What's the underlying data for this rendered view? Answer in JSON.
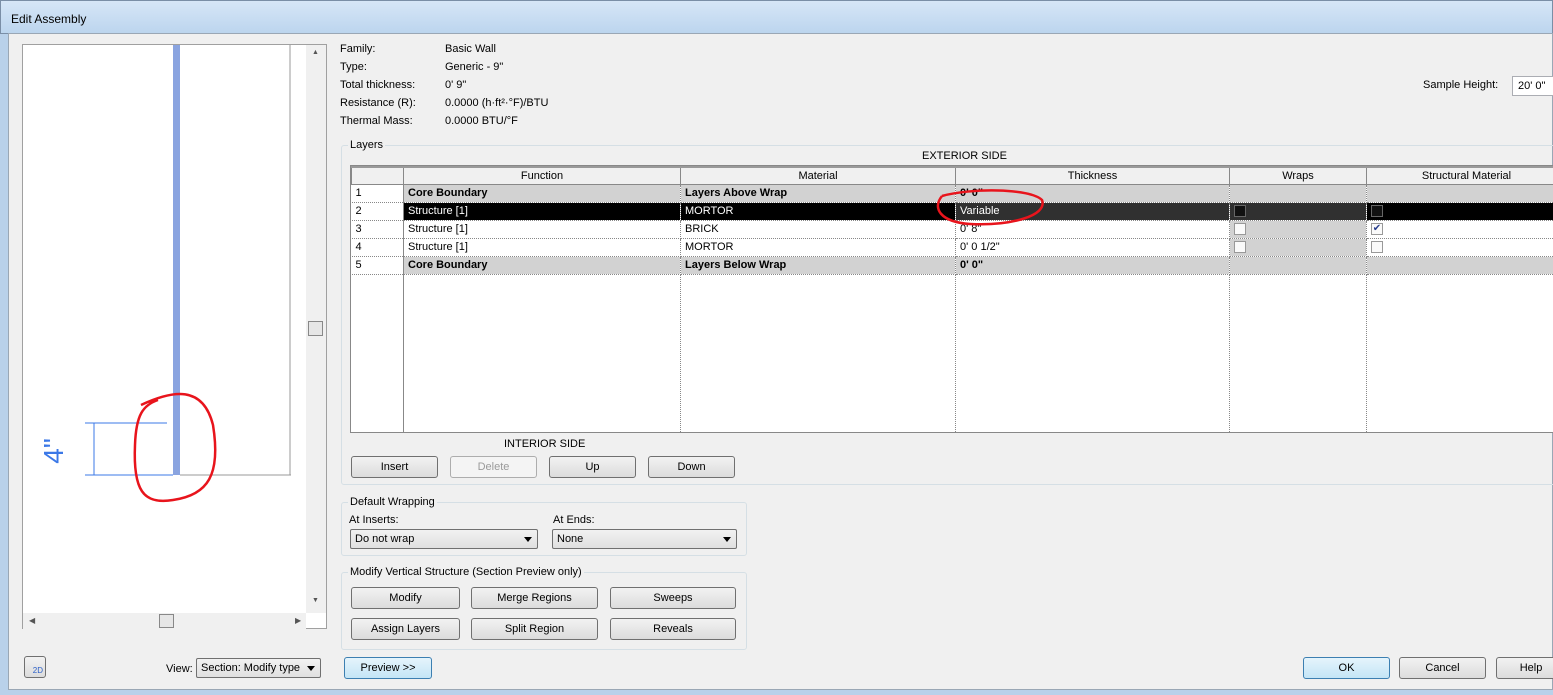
{
  "window": {
    "title": "Edit Assembly"
  },
  "info": [
    {
      "label": "Family:",
      "value": "Basic Wall"
    },
    {
      "label": "Type:",
      "value": "Generic - 9\""
    },
    {
      "label": "Total thickness:",
      "value": "0'  9\""
    },
    {
      "label": "Resistance (R):",
      "value": "0.0000 (h·ft²·°F)/BTU"
    },
    {
      "label": "Thermal Mass:",
      "value": "0.0000 BTU/°F"
    }
  ],
  "sample_height": {
    "label": "Sample Height:",
    "value": "20'  0\""
  },
  "layers": {
    "group_label": "Layers",
    "exterior_label": "EXTERIOR SIDE",
    "interior_label": "INTERIOR SIDE",
    "columns": [
      "Function",
      "Material",
      "Thickness",
      "Wraps",
      "Structural Material"
    ],
    "rows": [
      {
        "num": "1",
        "function": "Core Boundary",
        "material": "Layers Above Wrap",
        "thickness": "0'  0\"",
        "wraps": null,
        "structural": null
      },
      {
        "num": "2",
        "function": "Structure [1]",
        "material": "MORTOR",
        "thickness": "Variable",
        "wraps": false,
        "structural": false
      },
      {
        "num": "3",
        "function": "Structure [1]",
        "material": "BRICK",
        "thickness": "0'  8\"",
        "wraps": false,
        "structural": true
      },
      {
        "num": "4",
        "function": "Structure [1]",
        "material": "MORTOR",
        "thickness": "0'  0 1/2\"",
        "wraps": false,
        "structural": false
      },
      {
        "num": "5",
        "function": "Core Boundary",
        "material": "Layers Below Wrap",
        "thickness": "0'  0\"",
        "wraps": null,
        "structural": null
      }
    ],
    "buttons": {
      "insert": "Insert",
      "delete": "Delete",
      "up": "Up",
      "down": "Down"
    }
  },
  "default_wrapping": {
    "label": "Default Wrapping",
    "at_inserts_label": "At Inserts:",
    "at_inserts_value": "Do not wrap",
    "at_ends_label": "At  Ends:",
    "at_ends_value": "None"
  },
  "modify_vertical": {
    "label": "Modify Vertical Structure (Section Preview only)",
    "buttons": [
      "Modify",
      "Merge Regions",
      "Sweeps",
      "Assign Layers",
      "Split Region",
      "Reveals"
    ]
  },
  "preview": {
    "dimension": "4\"",
    "view_label": "View:",
    "view_value": "Section: Modify type",
    "toggle_2d": "2D"
  },
  "footer": {
    "preview": "Preview >>",
    "ok": "OK",
    "cancel": "Cancel",
    "help": "Help"
  },
  "colors": {
    "wall": "#8aa4e0",
    "annotation": "#e8141c",
    "dimension": "#3b78e7"
  }
}
